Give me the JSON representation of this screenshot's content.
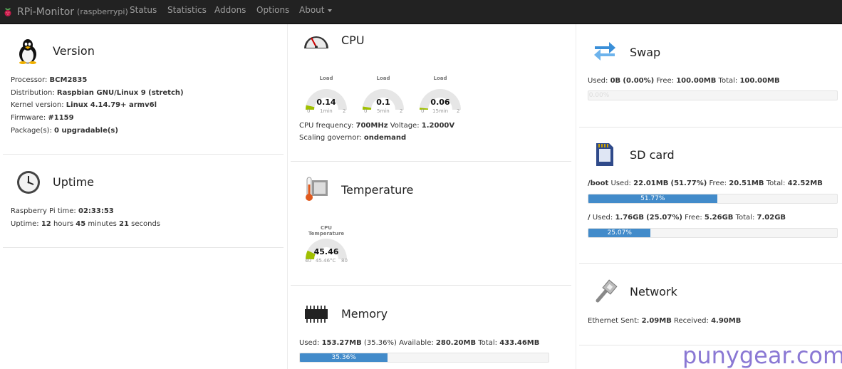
{
  "nav": {
    "brand": "RPi-Monitor",
    "host": "(raspberrypi)",
    "items": [
      "Status",
      "Statistics",
      "Addons",
      "Options",
      "About"
    ]
  },
  "version": {
    "title": "Version",
    "processor_label": "Processor:",
    "processor": "BCM2835",
    "distribution_label": "Distribution:",
    "distribution": "Raspbian GNU/Linux 9 (stretch)",
    "kernel_label": "Kernel version:",
    "kernel": "Linux 4.14.79+ armv6l",
    "firmware_label": "Firmware:",
    "firmware": "#1159",
    "packages_label": "Package(s):",
    "packages": "0 upgradable(s)"
  },
  "uptime": {
    "title": "Uptime",
    "time_label": "Raspberry Pi time:",
    "time": "02:33:53",
    "uptime_label": "Uptime:",
    "hours": "12",
    "hours_unit": "hours",
    "minutes": "45",
    "minutes_unit": "minutes",
    "seconds": "21",
    "seconds_unit": "seconds"
  },
  "cpu": {
    "title": "CPU",
    "gauges": [
      {
        "label": "Load",
        "value": "0.14",
        "min": "0",
        "max": "2",
        "sub": "1min",
        "fraction": 0.07
      },
      {
        "label": "Load",
        "value": "0.1",
        "min": "0",
        "max": "2",
        "sub": "5min",
        "fraction": 0.05
      },
      {
        "label": "Load",
        "value": "0.06",
        "min": "0",
        "max": "2",
        "sub": "15min",
        "fraction": 0.03
      }
    ],
    "freq_label": "CPU frequency:",
    "freq": "700MHz",
    "voltage_label": "Voltage:",
    "voltage": "1.2000V",
    "governor_label": "Scaling governor:",
    "governor": "ondemand"
  },
  "temperature": {
    "title": "Temperature",
    "gauge": {
      "label": "CPU Temperature",
      "value": "45.46",
      "min": "40",
      "max": "80",
      "sub": "45.46°C",
      "fraction": 0.14
    }
  },
  "memory": {
    "title": "Memory",
    "used_label": "Used:",
    "used": "153.27MB",
    "used_pct": "(35.36%)",
    "avail_label": "Available:",
    "available": "280.20MB",
    "total_label": "Total:",
    "total": "433.46MB",
    "bar_text": "35.36%",
    "bar_fraction": 0.3536
  },
  "swap": {
    "title": "Swap",
    "used_label": "Used:",
    "used": "0B",
    "used_pct": "(0.00%)",
    "free_label": "Free:",
    "free": "100.00MB",
    "total_label": "Total:",
    "total": "100.00MB",
    "bar_text": "0.00%",
    "bar_fraction": 0
  },
  "sdcard": {
    "title": "SD card",
    "boot": {
      "mount": "/boot",
      "used_label": "Used:",
      "used": "22.01MB",
      "used_pct": "(51.77%)",
      "free_label": "Free:",
      "free": "20.51MB",
      "total_label": "Total:",
      "total": "42.52MB",
      "bar_text": "51.77%",
      "bar_fraction": 0.5177
    },
    "root": {
      "mount": "/",
      "used_label": "Used:",
      "used": "1.76GB",
      "used_pct": "(25.07%)",
      "free_label": "Free:",
      "free": "5.26GB",
      "total_label": "Total:",
      "total": "7.02GB",
      "bar_text": "25.07%",
      "bar_fraction": 0.2507
    }
  },
  "network": {
    "title": "Network",
    "sent_label": "Ethernet Sent:",
    "sent": "2.09MB",
    "received_label": "Received:",
    "received": "4.90MB"
  },
  "watermark": "punygear.com",
  "colors": {
    "navbar": "#222222",
    "nav_text": "#9d9d9d",
    "bar_fill": "#428bca",
    "gauge_fill": "#a0c000",
    "gauge_track": "#e6e6e6"
  }
}
